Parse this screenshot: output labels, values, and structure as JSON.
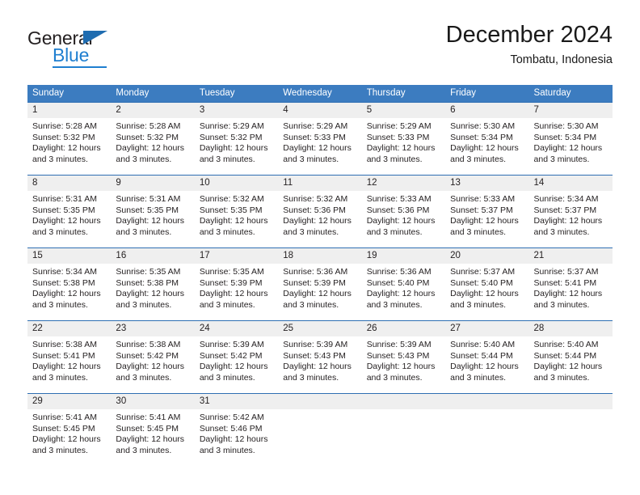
{
  "brand": {
    "name_part1": "General",
    "name_part2": "Blue",
    "triangle_icon": "triangle-icon",
    "accent_color": "#1f7fd0"
  },
  "header": {
    "month_title": "December 2024",
    "location": "Tombatu, Indonesia"
  },
  "theme": {
    "header_blue": "#3c7cc0",
    "row_divider_blue": "#2f6fb3",
    "daynum_band": "#efefef",
    "text": "#231f20"
  },
  "calendar": {
    "weekday_headers": [
      "Sunday",
      "Monday",
      "Tuesday",
      "Wednesday",
      "Thursday",
      "Friday",
      "Saturday"
    ],
    "weeks": [
      [
        {
          "day": "1",
          "sunrise": "Sunrise: 5:28 AM",
          "sunset": "Sunset: 5:32 PM",
          "daylight_l1": "Daylight: 12 hours",
          "daylight_l2": "and 3 minutes."
        },
        {
          "day": "2",
          "sunrise": "Sunrise: 5:28 AM",
          "sunset": "Sunset: 5:32 PM",
          "daylight_l1": "Daylight: 12 hours",
          "daylight_l2": "and 3 minutes."
        },
        {
          "day": "3",
          "sunrise": "Sunrise: 5:29 AM",
          "sunset": "Sunset: 5:32 PM",
          "daylight_l1": "Daylight: 12 hours",
          "daylight_l2": "and 3 minutes."
        },
        {
          "day": "4",
          "sunrise": "Sunrise: 5:29 AM",
          "sunset": "Sunset: 5:33 PM",
          "daylight_l1": "Daylight: 12 hours",
          "daylight_l2": "and 3 minutes."
        },
        {
          "day": "5",
          "sunrise": "Sunrise: 5:29 AM",
          "sunset": "Sunset: 5:33 PM",
          "daylight_l1": "Daylight: 12 hours",
          "daylight_l2": "and 3 minutes."
        },
        {
          "day": "6",
          "sunrise": "Sunrise: 5:30 AM",
          "sunset": "Sunset: 5:34 PM",
          "daylight_l1": "Daylight: 12 hours",
          "daylight_l2": "and 3 minutes."
        },
        {
          "day": "7",
          "sunrise": "Sunrise: 5:30 AM",
          "sunset": "Sunset: 5:34 PM",
          "daylight_l1": "Daylight: 12 hours",
          "daylight_l2": "and 3 minutes."
        }
      ],
      [
        {
          "day": "8",
          "sunrise": "Sunrise: 5:31 AM",
          "sunset": "Sunset: 5:35 PM",
          "daylight_l1": "Daylight: 12 hours",
          "daylight_l2": "and 3 minutes."
        },
        {
          "day": "9",
          "sunrise": "Sunrise: 5:31 AM",
          "sunset": "Sunset: 5:35 PM",
          "daylight_l1": "Daylight: 12 hours",
          "daylight_l2": "and 3 minutes."
        },
        {
          "day": "10",
          "sunrise": "Sunrise: 5:32 AM",
          "sunset": "Sunset: 5:35 PM",
          "daylight_l1": "Daylight: 12 hours",
          "daylight_l2": "and 3 minutes."
        },
        {
          "day": "11",
          "sunrise": "Sunrise: 5:32 AM",
          "sunset": "Sunset: 5:36 PM",
          "daylight_l1": "Daylight: 12 hours",
          "daylight_l2": "and 3 minutes."
        },
        {
          "day": "12",
          "sunrise": "Sunrise: 5:33 AM",
          "sunset": "Sunset: 5:36 PM",
          "daylight_l1": "Daylight: 12 hours",
          "daylight_l2": "and 3 minutes."
        },
        {
          "day": "13",
          "sunrise": "Sunrise: 5:33 AM",
          "sunset": "Sunset: 5:37 PM",
          "daylight_l1": "Daylight: 12 hours",
          "daylight_l2": "and 3 minutes."
        },
        {
          "day": "14",
          "sunrise": "Sunrise: 5:34 AM",
          "sunset": "Sunset: 5:37 PM",
          "daylight_l1": "Daylight: 12 hours",
          "daylight_l2": "and 3 minutes."
        }
      ],
      [
        {
          "day": "15",
          "sunrise": "Sunrise: 5:34 AM",
          "sunset": "Sunset: 5:38 PM",
          "daylight_l1": "Daylight: 12 hours",
          "daylight_l2": "and 3 minutes."
        },
        {
          "day": "16",
          "sunrise": "Sunrise: 5:35 AM",
          "sunset": "Sunset: 5:38 PM",
          "daylight_l1": "Daylight: 12 hours",
          "daylight_l2": "and 3 minutes."
        },
        {
          "day": "17",
          "sunrise": "Sunrise: 5:35 AM",
          "sunset": "Sunset: 5:39 PM",
          "daylight_l1": "Daylight: 12 hours",
          "daylight_l2": "and 3 minutes."
        },
        {
          "day": "18",
          "sunrise": "Sunrise: 5:36 AM",
          "sunset": "Sunset: 5:39 PM",
          "daylight_l1": "Daylight: 12 hours",
          "daylight_l2": "and 3 minutes."
        },
        {
          "day": "19",
          "sunrise": "Sunrise: 5:36 AM",
          "sunset": "Sunset: 5:40 PM",
          "daylight_l1": "Daylight: 12 hours",
          "daylight_l2": "and 3 minutes."
        },
        {
          "day": "20",
          "sunrise": "Sunrise: 5:37 AM",
          "sunset": "Sunset: 5:40 PM",
          "daylight_l1": "Daylight: 12 hours",
          "daylight_l2": "and 3 minutes."
        },
        {
          "day": "21",
          "sunrise": "Sunrise: 5:37 AM",
          "sunset": "Sunset: 5:41 PM",
          "daylight_l1": "Daylight: 12 hours",
          "daylight_l2": "and 3 minutes."
        }
      ],
      [
        {
          "day": "22",
          "sunrise": "Sunrise: 5:38 AM",
          "sunset": "Sunset: 5:41 PM",
          "daylight_l1": "Daylight: 12 hours",
          "daylight_l2": "and 3 minutes."
        },
        {
          "day": "23",
          "sunrise": "Sunrise: 5:38 AM",
          "sunset": "Sunset: 5:42 PM",
          "daylight_l1": "Daylight: 12 hours",
          "daylight_l2": "and 3 minutes."
        },
        {
          "day": "24",
          "sunrise": "Sunrise: 5:39 AM",
          "sunset": "Sunset: 5:42 PM",
          "daylight_l1": "Daylight: 12 hours",
          "daylight_l2": "and 3 minutes."
        },
        {
          "day": "25",
          "sunrise": "Sunrise: 5:39 AM",
          "sunset": "Sunset: 5:43 PM",
          "daylight_l1": "Daylight: 12 hours",
          "daylight_l2": "and 3 minutes."
        },
        {
          "day": "26",
          "sunrise": "Sunrise: 5:39 AM",
          "sunset": "Sunset: 5:43 PM",
          "daylight_l1": "Daylight: 12 hours",
          "daylight_l2": "and 3 minutes."
        },
        {
          "day": "27",
          "sunrise": "Sunrise: 5:40 AM",
          "sunset": "Sunset: 5:44 PM",
          "daylight_l1": "Daylight: 12 hours",
          "daylight_l2": "and 3 minutes."
        },
        {
          "day": "28",
          "sunrise": "Sunrise: 5:40 AM",
          "sunset": "Sunset: 5:44 PM",
          "daylight_l1": "Daylight: 12 hours",
          "daylight_l2": "and 3 minutes."
        }
      ],
      [
        {
          "day": "29",
          "sunrise": "Sunrise: 5:41 AM",
          "sunset": "Sunset: 5:45 PM",
          "daylight_l1": "Daylight: 12 hours",
          "daylight_l2": "and 3 minutes."
        },
        {
          "day": "30",
          "sunrise": "Sunrise: 5:41 AM",
          "sunset": "Sunset: 5:45 PM",
          "daylight_l1": "Daylight: 12 hours",
          "daylight_l2": "and 3 minutes."
        },
        {
          "day": "31",
          "sunrise": "Sunrise: 5:42 AM",
          "sunset": "Sunset: 5:46 PM",
          "daylight_l1": "Daylight: 12 hours",
          "daylight_l2": "and 3 minutes."
        },
        {
          "day": "",
          "sunrise": "",
          "sunset": "",
          "daylight_l1": "",
          "daylight_l2": ""
        },
        {
          "day": "",
          "sunrise": "",
          "sunset": "",
          "daylight_l1": "",
          "daylight_l2": ""
        },
        {
          "day": "",
          "sunrise": "",
          "sunset": "",
          "daylight_l1": "",
          "daylight_l2": ""
        },
        {
          "day": "",
          "sunrise": "",
          "sunset": "",
          "daylight_l1": "",
          "daylight_l2": ""
        }
      ]
    ]
  }
}
